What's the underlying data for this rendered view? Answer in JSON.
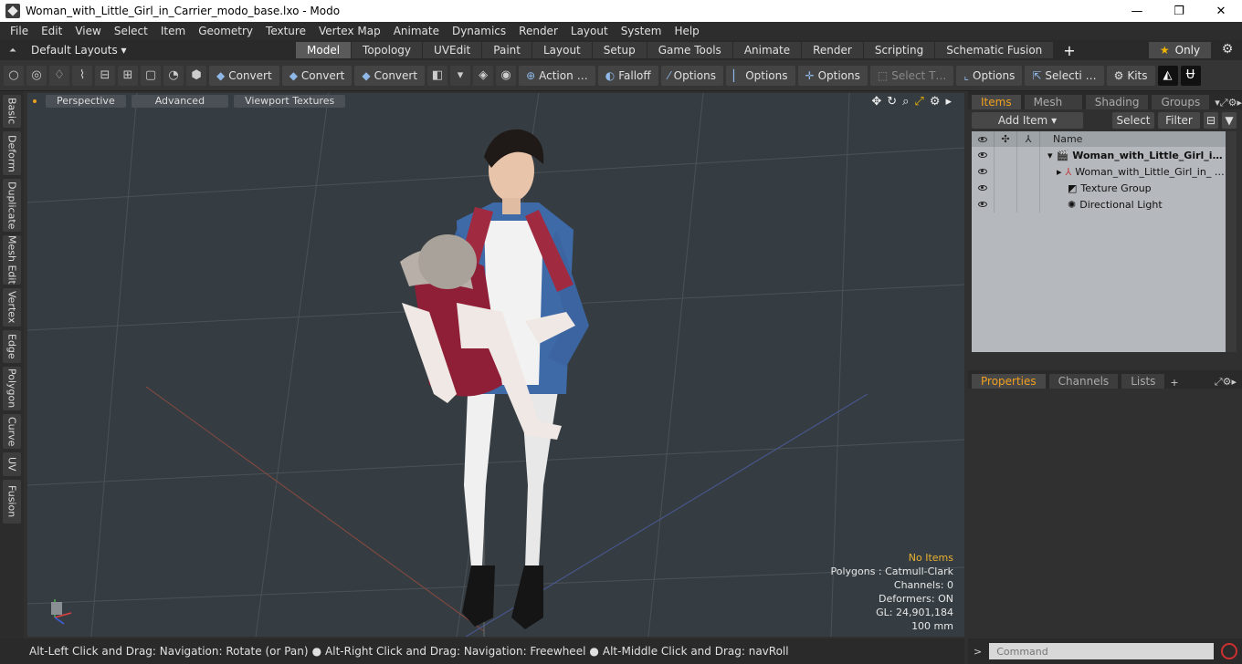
{
  "window": {
    "title": "Woman_with_Little_Girl_in_Carrier_modo_base.lxo - Modo",
    "minimize": "—",
    "maximize": "❐",
    "close": "✕"
  },
  "menu": [
    "File",
    "Edit",
    "View",
    "Select",
    "Item",
    "Geometry",
    "Texture",
    "Vertex Map",
    "Animate",
    "Dynamics",
    "Render",
    "Layout",
    "System",
    "Help"
  ],
  "layout": {
    "dropdown": "Default Layouts ▾",
    "tabs": [
      "Model",
      "Topology",
      "UVEdit",
      "Paint",
      "Layout",
      "Setup",
      "Game Tools",
      "Animate",
      "Render",
      "Scripting",
      "Schematic Fusion"
    ],
    "active_tab": "Model",
    "only_label": "Only"
  },
  "toolbar": {
    "convert1": "Convert",
    "convert2": "Convert",
    "convert3": "Convert",
    "action": "Action",
    "action_more": "…",
    "falloff": "Falloff",
    "options1": "Options",
    "options2": "Options",
    "options3": "Options",
    "select_t": "Select T…",
    "options4": "Options",
    "selecti": "Selecti …",
    "kits": "Kits"
  },
  "side_tabs": [
    "Basic",
    "Deform",
    "Duplicate",
    "Mesh Edit",
    "Vertex",
    "Edge",
    "Polygon",
    "Curve",
    "UV",
    "Fusion"
  ],
  "viewport": {
    "tabs": [
      "Perspective",
      "Advanced",
      "Viewport Textures"
    ],
    "info": {
      "no_items": "No Items",
      "polygons": "Polygons : Catmull-Clark",
      "channels": "Channels: 0",
      "deformers": "Deformers: ON",
      "gl": "GL: 24,901,184",
      "scale": "100 mm"
    }
  },
  "items_panel": {
    "tabs": [
      "Items",
      "Mesh …",
      "Shading",
      "Groups"
    ],
    "active_tab": "Items",
    "add_item": "Add Item",
    "select": "Select",
    "filter": "Filter",
    "col_name": "Name",
    "rows": [
      {
        "label": "Woman_with_Little_Girl_i…",
        "bold": true
      },
      {
        "label": "Woman_with_Little_Girl_in_ …"
      },
      {
        "label": "Texture Group"
      },
      {
        "label": "Directional Light"
      }
    ]
  },
  "props_panel": {
    "tabs": [
      "Properties",
      "Channels",
      "Lists"
    ],
    "active_tab": "Properties"
  },
  "status": {
    "hint1": "Alt-Left Click and Drag: Navigation: Rotate (or Pan)",
    "hint2": "Alt-Right Click and Drag: Navigation: Freewheel",
    "hint3": "Alt-Middle Click and Drag: navRoll"
  },
  "command": {
    "placeholder": "Command"
  }
}
